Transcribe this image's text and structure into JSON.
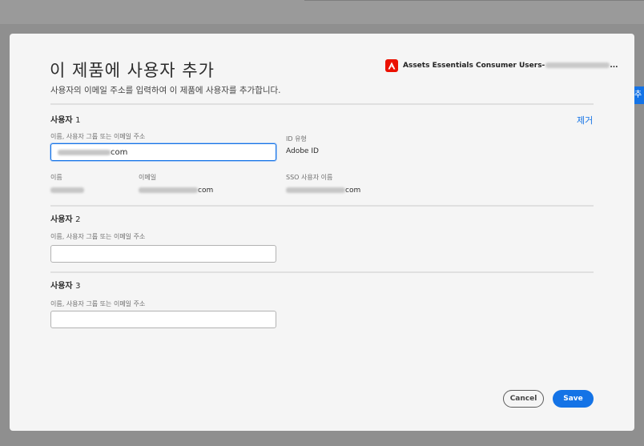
{
  "background": {
    "tab_label": "추가"
  },
  "dialog": {
    "title": "이 제품에 사용자 추가",
    "subtitle": "사용자의 이메일 주소를 입력하여 이 제품에 사용자를 추가합니다.",
    "product": {
      "icon": "adobe-logo-icon",
      "name_prefix": "Assets Essentials Consumer Users-",
      "ellipsis": "..."
    },
    "remove_label": "제거",
    "users": [
      {
        "heading": "사용자",
        "number": "1",
        "field_label": "이름, 사용자 그룹 또는 이메일 주소",
        "input_suffix": "com",
        "id_type_label": "ID 유형",
        "id_type_value": "Adobe ID",
        "name_label": "이름",
        "email_label": "이메일",
        "email_suffix": "com",
        "sso_label": "SSO 사용자 이름",
        "sso_suffix": "com"
      },
      {
        "heading": "사용자",
        "number": "2",
        "field_label": "이름, 사용자 그룹 또는 이메일 주소",
        "input_value": ""
      },
      {
        "heading": "사용자",
        "number": "3",
        "field_label": "이름, 사용자 그룹 또는 이메일 주소",
        "input_value": ""
      }
    ],
    "buttons": {
      "cancel": "Cancel",
      "save": "Save"
    },
    "colors": {
      "accent": "#1473e6",
      "brand": "#eb1000",
      "panel": "#f5f5f5"
    }
  }
}
